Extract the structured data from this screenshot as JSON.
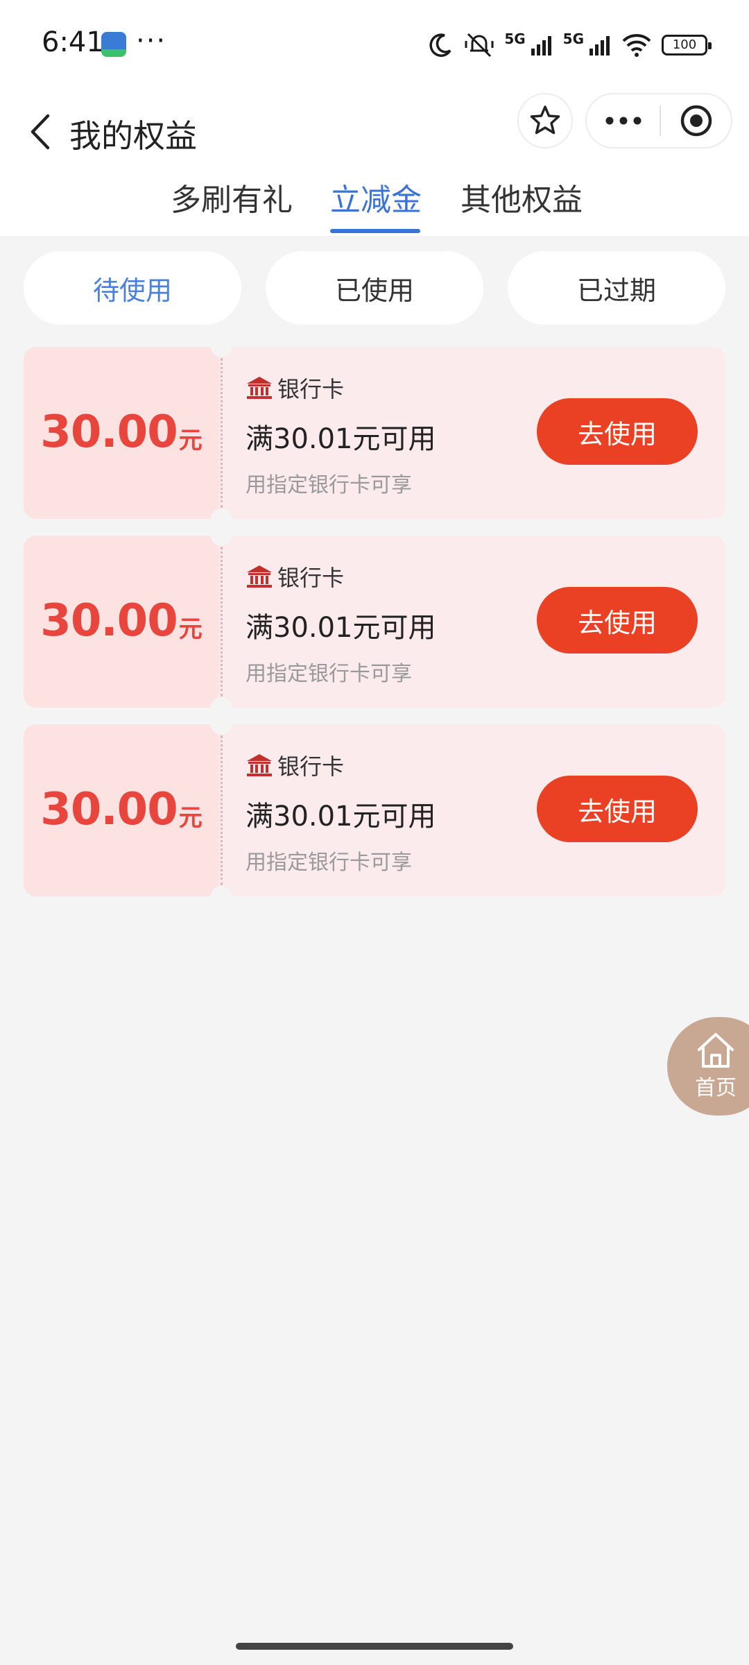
{
  "status_bar": {
    "time": "6:41",
    "more": "···",
    "network_label": "5G",
    "network_label_2": "5G",
    "battery": "100"
  },
  "header": {
    "title": "我的权益"
  },
  "tabs": [
    {
      "label": "多刷有礼",
      "active": false
    },
    {
      "label": "立减金",
      "active": true
    },
    {
      "label": "其他权益",
      "active": false
    }
  ],
  "filters": [
    {
      "label": "待使用",
      "active": true
    },
    {
      "label": "已使用",
      "active": false
    },
    {
      "label": "已过期",
      "active": false
    }
  ],
  "coupons": [
    {
      "amount": "30.00",
      "unit": "元",
      "card_type": "银行卡",
      "condition": "满30.01元可用",
      "note": "用指定银行卡可享",
      "button": "去使用"
    },
    {
      "amount": "30.00",
      "unit": "元",
      "card_type": "银行卡",
      "condition": "满30.01元可用",
      "note": "用指定银行卡可享",
      "button": "去使用"
    },
    {
      "amount": "30.00",
      "unit": "元",
      "card_type": "银行卡",
      "condition": "满30.01元可用",
      "note": "用指定银行卡可享",
      "button": "去使用"
    }
  ],
  "home_fab": {
    "label": "首页"
  },
  "colors": {
    "accent_blue": "#3a72d9",
    "coupon_red": "#e8453c",
    "button_red": "#ea4125",
    "home_fab": "#c9a893"
  }
}
